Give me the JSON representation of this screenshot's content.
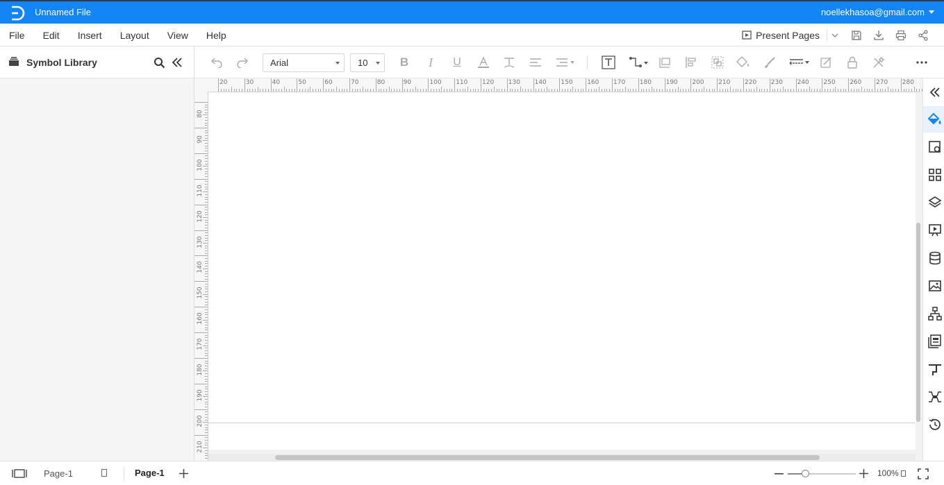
{
  "app": {
    "file_title": "Unnamed File",
    "account_email": "noellekhasoa@gmail.com",
    "brand_color": "#1385f5"
  },
  "menu": [
    "File",
    "Edit",
    "Insert",
    "Layout",
    "View",
    "Help"
  ],
  "actions": {
    "present_label": "Present Pages",
    "icons": [
      "save-icon",
      "download-icon",
      "print-icon",
      "share-icon"
    ]
  },
  "sidebar": {
    "title": "Symbol Library",
    "icons": [
      "library-icon",
      "search-icon",
      "collapse-left-icon"
    ]
  },
  "toolbar": {
    "font_family": "Arial",
    "font_size": "10",
    "icons": [
      "undo-icon",
      "redo-icon",
      "bold-icon",
      "italic-icon",
      "underline-icon",
      "font-color-icon",
      "text-style-icon",
      "align-icon",
      "line-spacing-icon",
      "text-box-icon",
      "connector-icon",
      "container-icon",
      "align-shapes-icon",
      "group-icon",
      "fill-icon",
      "line-color-icon",
      "line-style-icon",
      "edit-shape-icon",
      "lock-icon",
      "tools-icon",
      "more-icon"
    ]
  },
  "rulers": {
    "horizontal": [
      "20",
      "30",
      "40",
      "50",
      "60",
      "70",
      "80",
      "90",
      "100",
      "110",
      "120",
      "130",
      "140",
      "150",
      "160",
      "170",
      "180",
      "190",
      "200",
      "210",
      "220",
      "230",
      "240",
      "250",
      "260",
      "270",
      "280"
    ],
    "vertical": [
      "80",
      "90",
      "100",
      "110",
      "120",
      "130",
      "140",
      "150",
      "160",
      "170",
      "180",
      "190",
      "200",
      "210"
    ]
  },
  "right_panel": {
    "icons": [
      "collapse-right-icon",
      "fill-style-icon",
      "page-setup-icon",
      "components-icon",
      "layers-icon",
      "presentation-icon",
      "data-icon",
      "image-icon",
      "org-chart-icon",
      "template-icon",
      "connector-style-icon",
      "mind-map-icon",
      "history-icon"
    ],
    "active_index": 1
  },
  "footer": {
    "page_tab_inactive": "Page-1",
    "page_tab_active": "Page-1",
    "zoom_label": "100%",
    "zoom_fraction": 0.25
  }
}
